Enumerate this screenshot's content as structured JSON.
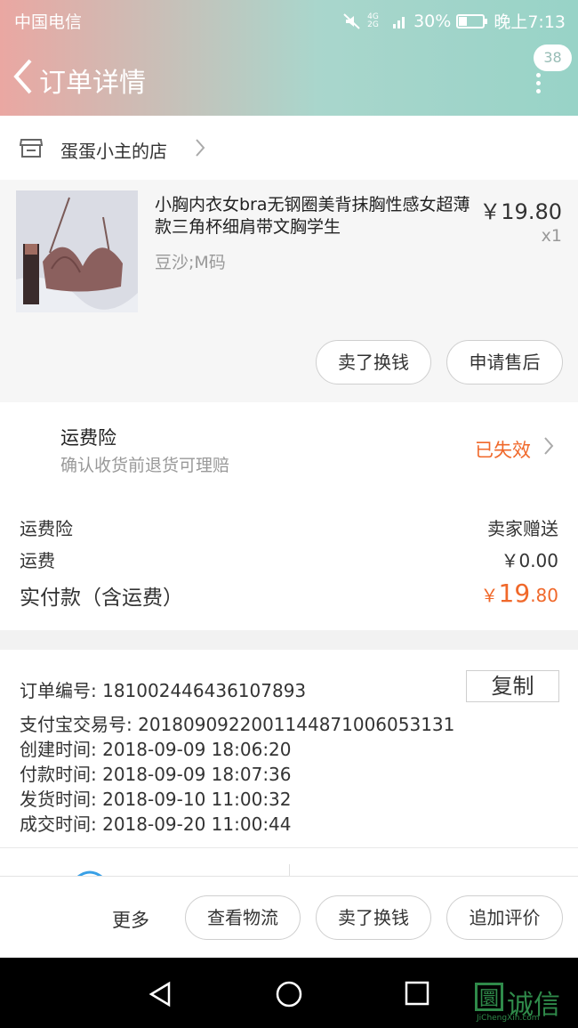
{
  "status_bar": {
    "carrier": "中国电信",
    "network": "4G 2G",
    "battery": "30%",
    "time": "晚上7:13"
  },
  "nav": {
    "title": "订单详情",
    "badge_count": "38"
  },
  "shop": {
    "name": "蛋蛋小主的店"
  },
  "product": {
    "title": "小胸内衣女bra无钢圈美背抹胸性感女超薄款三角杯细肩带文胸学生",
    "sku": "豆沙;M码",
    "price": "￥19.80",
    "quantity": "x1",
    "btn_sell": "卖了换钱",
    "btn_aftersale": "申请售后"
  },
  "insurance": {
    "title": "运费险",
    "subtitle": "确认收货前退货可理赔",
    "status": "已失效"
  },
  "fees": {
    "insurance_label": "运费险",
    "insurance_value": "卖家赠送",
    "shipping_label": "运费",
    "shipping_value": "￥0.00",
    "paid_label": "实付款（含运费）",
    "paid_currency": "￥",
    "paid_int": "19",
    "paid_dec": ".80"
  },
  "order_info": {
    "order_no": "订单编号:   181002446436107893",
    "copy_label": "复制",
    "alipay_no": "支付宝交易号:   2018090922001144871006053131",
    "created": "创建时间:   2018-09-09 18:06:20",
    "paid": "付款时间:   2018-09-09 18:07:36",
    "shipped": "发货时间:   2018-09-10 11:00:32",
    "completed": "成交时间:   2018-09-20 11:00:44"
  },
  "actions": {
    "more": "更多",
    "logistics": "查看物流",
    "sell": "卖了换钱",
    "review": "追加评价"
  },
  "watermark": {
    "glyph": "圜",
    "text": "诚信",
    "url": "JiChengXin.com"
  },
  "colors": {
    "accent": "#f0682a",
    "header_gradient_start": "#eaa7a2",
    "header_gradient_end": "#98d3c7"
  }
}
